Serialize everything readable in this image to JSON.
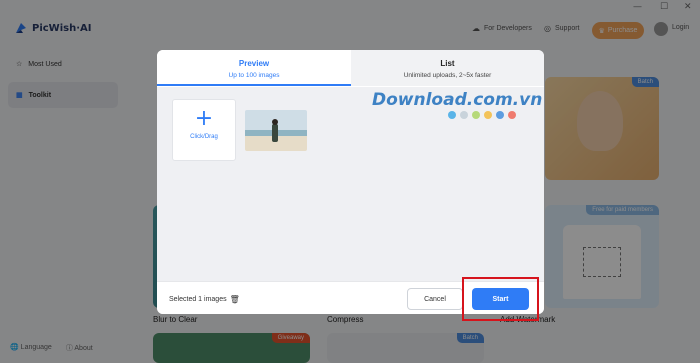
{
  "app": {
    "name": "PicWish·AI"
  },
  "window": {
    "minimize": "—",
    "maximize": "☐",
    "close": "✕"
  },
  "header": {
    "developers": "For Developers",
    "support": "Support",
    "purchase": "Purchase",
    "login": "Login"
  },
  "sidebar": {
    "items": [
      {
        "label": "Most Used",
        "icon": "star-icon"
      },
      {
        "label": "Toolkit",
        "icon": "grid-icon"
      }
    ],
    "language": "Language",
    "about": "About"
  },
  "background_cards": {
    "blur_to_clear": "Blur to Clear",
    "compress": "Compress",
    "add_watermark": "Add Watermark",
    "batch_tag": "Batch",
    "free_tag": "Free for paid members",
    "giveaway_tag": "Giveaway"
  },
  "modal": {
    "tabs": [
      {
        "title": "Preview",
        "subtitle": "Up to 100 images"
      },
      {
        "title": "List",
        "subtitle": "Unlimited uploads, 2~5x faster"
      }
    ],
    "add_label": "Click/Drag",
    "selected_text": "Selected 1 images",
    "cancel": "Cancel",
    "start": "Start"
  },
  "watermark": {
    "text": "Download.com.vn",
    "dot_colors": [
      "#5ab4e8",
      "#c9d3db",
      "#b6d97a",
      "#f3c35a",
      "#5d9de0",
      "#ef7b6f"
    ]
  },
  "colors": {
    "accent": "#2f7cf6",
    "highlight": "#d6141c",
    "purchase": "#f3a45a"
  }
}
